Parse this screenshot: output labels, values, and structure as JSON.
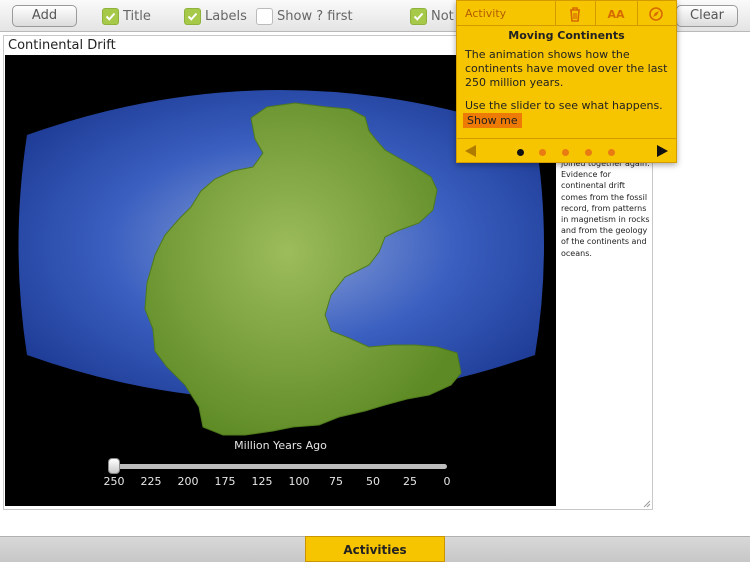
{
  "toolbar": {
    "add_label": "Add",
    "clear_label": "Clear",
    "checkboxes": [
      {
        "label": "Title",
        "checked": true
      },
      {
        "label": "Labels",
        "checked": true
      },
      {
        "label": "Show ? first",
        "checked": false
      },
      {
        "label": "Not",
        "checked": true
      }
    ]
  },
  "panel": {
    "title": "Continental Drift",
    "side_text": "joined together again. Evidence for continental drift comes from the fossil record, from patterns in magnetism in rocks and from the geology of the continents and oceans."
  },
  "slider": {
    "caption": "Million Years Ago",
    "ticks": [
      "250",
      "225",
      "200",
      "175",
      "125",
      "100",
      "75",
      "50",
      "25",
      "0"
    ],
    "value": "250"
  },
  "popup": {
    "header_label": "Activity",
    "title": "Moving Continents",
    "paragraph1": "The animation shows how the continents have moved over the last 250 million years.",
    "paragraph2": "Use the slider to see what happens.",
    "show_me": "Show me",
    "font_size_label": "AA",
    "pages": 5,
    "current_page": 1
  },
  "bottom": {
    "activities_label": "Activities"
  },
  "colors": {
    "accent": "#f7c400",
    "highlight": "#ee7a06",
    "ocean": "#2a4fb0",
    "land": "#6e9a2c",
    "checkbox_on": "#a6c94a"
  },
  "icons": [
    "trash-icon",
    "font-size-icon",
    "compass-icon",
    "check-icon",
    "arrow-left-icon",
    "arrow-right-icon"
  ]
}
